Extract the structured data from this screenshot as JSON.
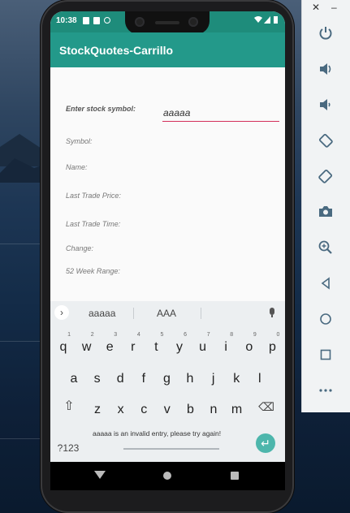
{
  "status_bar": {
    "time": "10:38"
  },
  "app": {
    "title": "StockQuotes-Carrillo"
  },
  "form": {
    "symbol_prompt": "Enter stock symbol:",
    "symbol_value": "aaaaa",
    "labels": {
      "symbol": "Symbol:",
      "name": "Name:",
      "last_trade_price": "Last Trade Price:",
      "last_trade_time": "Last Trade Time:",
      "change": "Change:",
      "week_range": "52 Week Range:"
    }
  },
  "keyboard": {
    "suggestions": [
      "aaaaa",
      "AAA"
    ],
    "row1": [
      {
        "k": "q",
        "n": "1"
      },
      {
        "k": "w",
        "n": "2"
      },
      {
        "k": "e",
        "n": "3"
      },
      {
        "k": "r",
        "n": "4"
      },
      {
        "k": "t",
        "n": "5"
      },
      {
        "k": "y",
        "n": "6"
      },
      {
        "k": "u",
        "n": "7"
      },
      {
        "k": "i",
        "n": "8"
      },
      {
        "k": "o",
        "n": "9"
      },
      {
        "k": "p",
        "n": "0"
      }
    ],
    "row2": [
      "a",
      "s",
      "d",
      "f",
      "g",
      "h",
      "j",
      "k",
      "l"
    ],
    "row3": [
      "z",
      "x",
      "c",
      "v",
      "b",
      "n",
      "m"
    ],
    "symbols_label": "?123",
    "toast": "aaaaa is an invalid entry, please try again!"
  },
  "icons": {
    "power": "power-icon",
    "volume_up": "volume-up-icon",
    "volume_down": "volume-down-icon",
    "rotate_left": "rotate-left-icon",
    "rotate_right": "rotate-right-icon",
    "camera": "camera-icon",
    "zoom": "zoom-icon",
    "back": "back-icon",
    "home": "home-icon",
    "overview": "overview-icon",
    "more": "more-icon"
  },
  "colors": {
    "primary": "#23998a",
    "primary_dark": "#1e8c7b",
    "accent": "#d32f5a",
    "enter": "#4db6ac"
  }
}
